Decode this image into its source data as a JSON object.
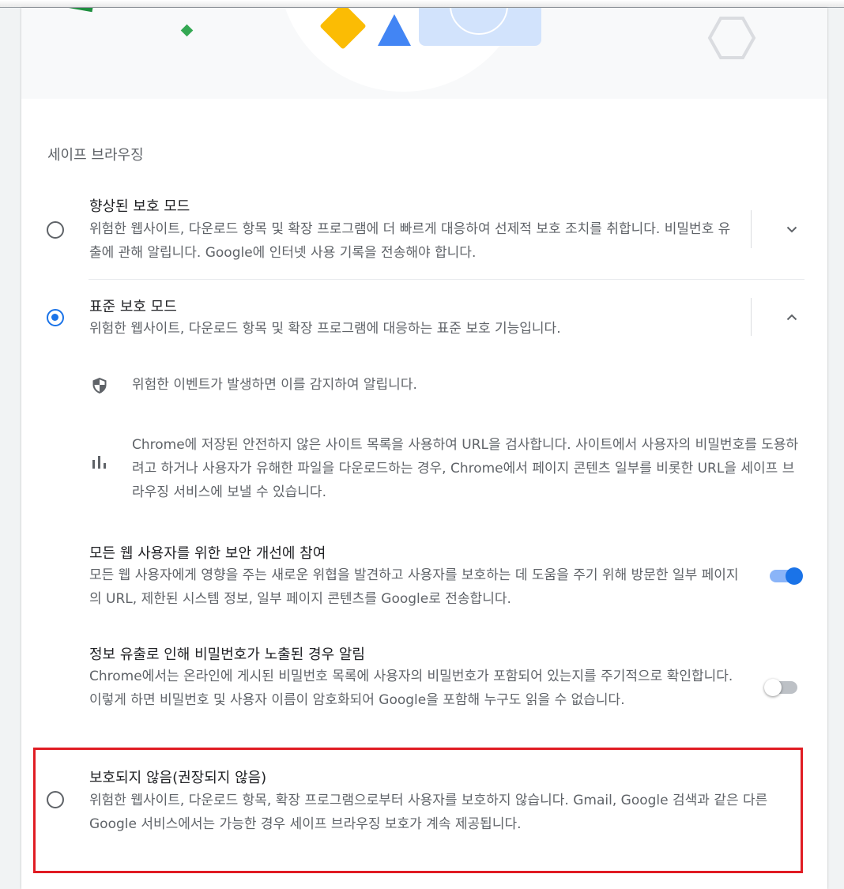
{
  "section_title": "세이프 브라우징",
  "options": {
    "enhanced": {
      "title": "향상된 보호 모드",
      "description": "위험한 웹사이트, 다운로드 항목 및 확장 프로그램에 더 빠르게 대응하여 선제적 보호 조치를 취합니다. 비밀번호 유출에 관해 알립니다. Google에 인터넷 사용 기록을 전송해야 합니다.",
      "selected": false,
      "expanded": false
    },
    "standard": {
      "title": "표준 보호 모드",
      "description": "위험한 웹사이트, 다운로드 항목 및 확장 프로그램에 대응하는 표준 보호 기능입니다.",
      "selected": true,
      "expanded": true
    },
    "none": {
      "title": "보호되지 않음(권장되지 않음)",
      "description": "위험한 웹사이트, 다운로드 항목, 확장 프로그램으로부터 사용자를 보호하지 않습니다. Gmail, Google 검색과 같은 다른 Google 서비스에서는 가능한 경우 세이프 브라우징 보호가 계속 제공됩니다.",
      "selected": false
    }
  },
  "standard_features": [
    {
      "icon": "shield-icon",
      "text": "위험한 이벤트가 발생하면 이를 감지하여 알립니다."
    },
    {
      "icon": "bar-chart-icon",
      "text": "Chrome에 저장된 안전하지 않은 사이트 목록을 사용하여 URL을 검사합니다. 사이트에서 사용자의 비밀번호를 도용하려고 하거나 사용자가 유해한 파일을 다운로드하는 경우, Chrome에서 페이지 콘텐츠 일부를 비롯한 URL을 세이프 브라우징 서비스에 보낼 수 있습니다."
    }
  ],
  "toggles": {
    "improve_security": {
      "title": "모든 웹 사용자를 위한 보안 개선에 참여",
      "description": "모든 웹 사용자에게 영향을 주는 새로운 위협을 발견하고 사용자를 보호하는 데 도움을 주기 위해 방문한 일부 페이지의 URL, 제한된 시스템 정보, 일부 페이지 콘텐츠를 Google로 전송합니다.",
      "enabled": true
    },
    "password_leak": {
      "title": "정보 유출로 인해 비밀번호가 노출된 경우 알림",
      "description": "Chrome에서는 온라인에 게시된 비밀번호 목록에 사용자의 비밀번호가 포함되어 있는지를 주기적으로 확인합니다. 이렇게 하면 비밀번호 및 사용자 이름이 암호화되어 Google을 포함해 누구도 읽을 수 없습니다.",
      "enabled": false
    }
  },
  "colors": {
    "accent": "#1a73e8",
    "highlight_border": "#e01c23"
  }
}
